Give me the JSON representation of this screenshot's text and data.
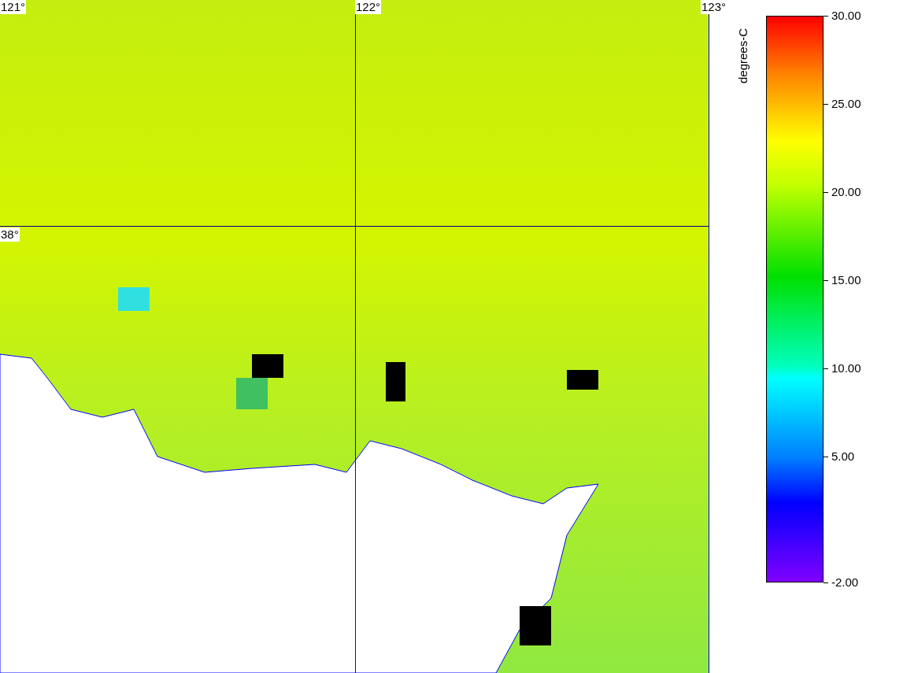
{
  "map": {
    "longitude_labels": [
      "121°",
      "122°",
      "123°"
    ],
    "latitude_labels": [
      "38°"
    ]
  },
  "legend": {
    "unit": "degrees-C",
    "ticks": [
      "30.00",
      "25.00",
      "20.00",
      "15.00",
      "10.00",
      "5.00",
      "-2.00"
    ]
  }
}
